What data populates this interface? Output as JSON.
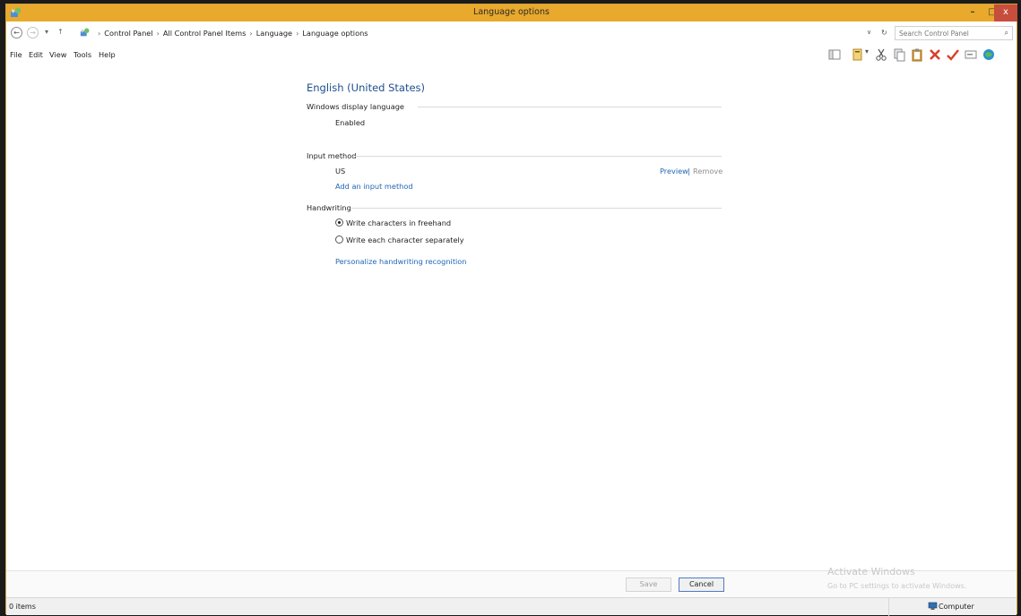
{
  "window": {
    "title": "Language options"
  },
  "titlebar_buttons": {
    "minimize": "–",
    "maximize": "□",
    "close": "x"
  },
  "address": {
    "breadcrumbs": [
      "Control Panel",
      "All Control Panel Items",
      "Language",
      "Language options"
    ],
    "search_placeholder": "Search Control Panel"
  },
  "menu": [
    {
      "label": "File"
    },
    {
      "label": "Edit"
    },
    {
      "label": "View"
    },
    {
      "label": "Tools"
    },
    {
      "label": "Help"
    }
  ],
  "language": {
    "title": "English (United States)",
    "display_section": {
      "label": "Windows display language",
      "status": "Enabled"
    },
    "input_section": {
      "label": "Input method",
      "method": "US",
      "preview_link": "Preview",
      "separator": "|",
      "remove_link": "Remove",
      "add_link": "Add an input method"
    },
    "handwriting_section": {
      "label": "Handwriting",
      "options": [
        {
          "label": "Write characters in freehand",
          "selected": true
        },
        {
          "label": "Write each character separately",
          "selected": false
        }
      ],
      "personalize_link": "Personalize handwriting recognition"
    }
  },
  "footer": {
    "save_label": "Save",
    "cancel_label": "Cancel",
    "watermark_title": "Activate Windows",
    "watermark_sub": "Go to PC settings to activate Windows."
  },
  "status": {
    "items": "0 items",
    "location": "Computer"
  },
  "colors": {
    "titlebar": "#e8a92c",
    "link": "#1f67b5",
    "heading": "#1e4e91",
    "close": "#c74d3c"
  }
}
